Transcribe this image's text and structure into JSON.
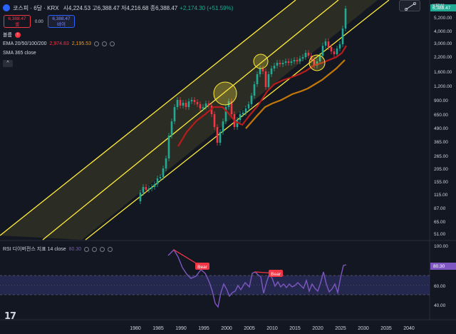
{
  "header": {
    "symbol_title": "코스피 · 6달 · KRX",
    "ohlc": "시4,224.53 고6,388.47 저4,216.68 종6,388.47",
    "change": "+2,174.30 (+51.59%)",
    "sell_price": "6,388.47",
    "sell_label": "셀",
    "spread": "0.00",
    "buy_price": "6,388.47",
    "buy_label": "바이",
    "currency": "KRW"
  },
  "indicators": {
    "volume_label": "볼륨",
    "ema_label": "EMA 20/50/100/200",
    "ema_value_1": "2,974.83",
    "ema_value_2": "2,195.53",
    "sma_label": "SMA 365 close",
    "collapse_glyph": "^"
  },
  "rsi": {
    "label": "RSI 디이버전스 지표 14 close",
    "value": "80.30",
    "bear_label_1": "Bear",
    "bear_label_2": "Bear",
    "axis_labels": [
      "100.00",
      "80.00",
      "60.00",
      "40.00"
    ]
  },
  "price_axis": [
    "5,200.00",
    "4,000.00",
    "3,000.00",
    "2,200.00",
    "1,600.00",
    "1,200.00",
    "900.00",
    "650.00",
    "490.00",
    "365.00",
    "265.00",
    "205.00",
    "155.00",
    "115.00",
    "87.00",
    "65.00",
    "51.00"
  ],
  "time_axis": [
    "1980",
    "1985",
    "1990",
    "1995",
    "2000",
    "2005",
    "2010",
    "2015",
    "2020",
    "2025",
    "2030",
    "2035",
    "2040"
  ],
  "colors": {
    "background": "#131722",
    "up": "#22ab94",
    "down": "#f23645",
    "channel": "#ffeb3b",
    "ema": "#b71c1c",
    "sma": "#ff9800",
    "rsi_line": "#7e57c2",
    "rsi_band": "#2a2d5a"
  },
  "icons": [
    "visibility-icon",
    "settings-icon",
    "delete-icon",
    "more-icon",
    "collapse-icon",
    "tradingview-logo-icon",
    "drawing-tool-icon"
  ]
}
